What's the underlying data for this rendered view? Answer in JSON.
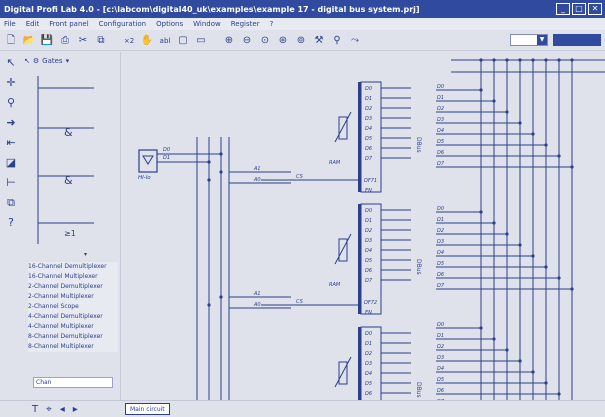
{
  "window": {
    "title": "Digital Profi Lab 4.0 - [c:\\labcom\\digital40_uk\\examples\\example 17 - digital bus system.prj]"
  },
  "menu": [
    "File",
    "Edit",
    "Front panel",
    "Configuration",
    "Options",
    "Window",
    "Register",
    "?"
  ],
  "toolbar": {
    "x2": "×2",
    "abl": "abl"
  },
  "gates": {
    "label": "Gates"
  },
  "components": [
    "16-Channel Demultiplexer",
    "16-Channel Multiplexer",
    "2-Channel Demultiplexer",
    "2-Channel Multiplexer",
    "2-Channel Scope",
    "4-Channel Demultiplexer",
    "4-Channel Multiplexer",
    "8-Channel Demultiplexer",
    "8-Channel Multiplexer"
  ],
  "search": {
    "value": "Chan"
  },
  "tab": {
    "label": "Main circuit"
  },
  "circuit": {
    "hilo_label": "HI-lo",
    "d_outputs": [
      "D0",
      "D1",
      "D2",
      "D3",
      "D4",
      "D5",
      "D6",
      "D7"
    ],
    "bus_label": "DBus",
    "signals": [
      "D0",
      "D1"
    ],
    "a_labels": [
      "A0",
      "A1"
    ],
    "cs_label": "CS",
    "chips": [
      "DF71",
      "DF72"
    ],
    "en_label": "EN",
    "ram_label": "RAM"
  }
}
